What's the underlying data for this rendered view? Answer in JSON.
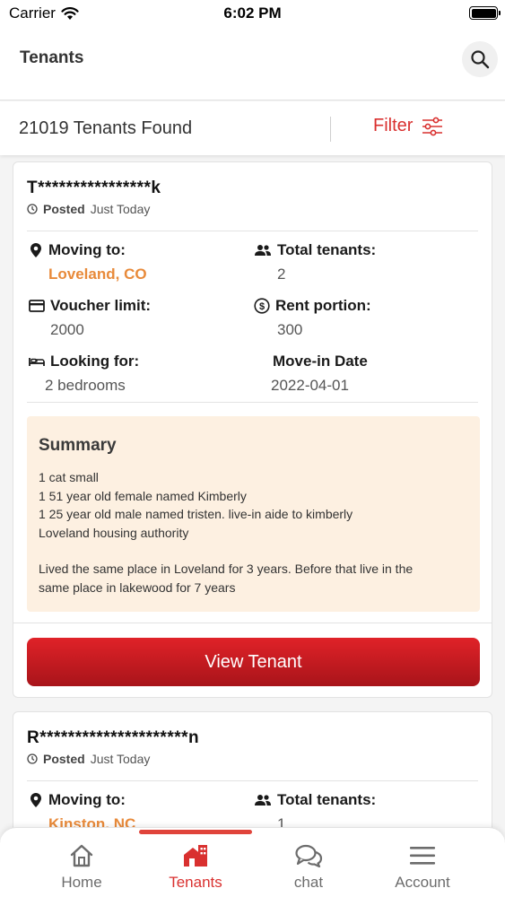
{
  "status_bar": {
    "carrier": "Carrier",
    "time": "6:02 PM"
  },
  "header": {
    "title": "Tenants"
  },
  "results": {
    "count_text": "21019 Tenants Found",
    "filter_label": "Filter"
  },
  "labels": {
    "posted": "Posted",
    "moving_to": "Moving to:",
    "total_tenants": "Total tenants:",
    "voucher_limit": "Voucher limit:",
    "rent_portion": "Rent portion:",
    "looking_for": "Looking for:",
    "move_in_date": "Move-in Date",
    "summary": "Summary",
    "view_tenant": "View Tenant"
  },
  "tenants": [
    {
      "masked_name": "T****************k",
      "posted_when": "Just Today",
      "moving_to": "Loveland, CO",
      "total_tenants": "2",
      "voucher_limit": "2000",
      "rent_portion": "300",
      "looking_for": "2 bedrooms",
      "move_in_date": "2022-04-01",
      "summary_lines": [
        "1 cat small",
        "1 51 year old female named Kimberly",
        "1 25 year old male named tristen. live-in aide to kimberly",
        "Loveland housing authority",
        "Lived the same place in Loveland for 3 years. Before that live in the",
        "same place in lakewood for 7 years"
      ]
    },
    {
      "masked_name": "R*********************n",
      "posted_when": "Just Today",
      "moving_to": "Kinston, NC",
      "total_tenants": "1"
    }
  ],
  "tabs": [
    {
      "label": "Home",
      "icon": "home-icon",
      "active": false
    },
    {
      "label": "Tenants",
      "icon": "building-icon",
      "active": true
    },
    {
      "label": "chat",
      "icon": "chat-icon",
      "active": false
    },
    {
      "label": "Account",
      "icon": "menu-icon",
      "active": false
    }
  ],
  "colors": {
    "accent": "#d9302f",
    "location": "#e88a3a",
    "summary_bg": "#fdf0e1",
    "button": "#c81c22"
  }
}
